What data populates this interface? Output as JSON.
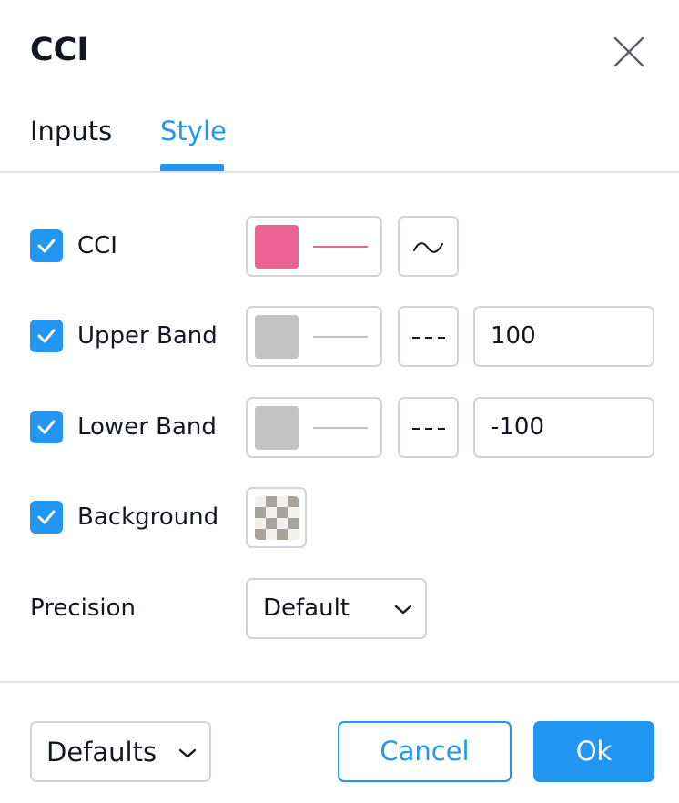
{
  "dialog": {
    "title": "CCI",
    "tabs": [
      {
        "label": "Inputs",
        "active": false
      },
      {
        "label": "Style",
        "active": true
      }
    ]
  },
  "colors": {
    "accent": "#2196f3",
    "cci_plot": "#ec6293",
    "band": "#c3c3c3",
    "border": "#d1d4dc"
  },
  "rows": {
    "cci": {
      "label": "CCI",
      "checked": true,
      "plot_style_icon": "wave-line-icon"
    },
    "upper_band": {
      "label": "Upper Band",
      "checked": true,
      "line_style_icon": "dashed-line-icon",
      "value": "100"
    },
    "lower_band": {
      "label": "Lower Band",
      "checked": true,
      "line_style_icon": "dashed-line-icon",
      "value": "-100"
    },
    "background": {
      "label": "Background",
      "checked": true
    }
  },
  "precision": {
    "label": "Precision",
    "selected": "Default"
  },
  "footer": {
    "defaults_label": "Defaults",
    "cancel_label": "Cancel",
    "ok_label": "Ok"
  }
}
